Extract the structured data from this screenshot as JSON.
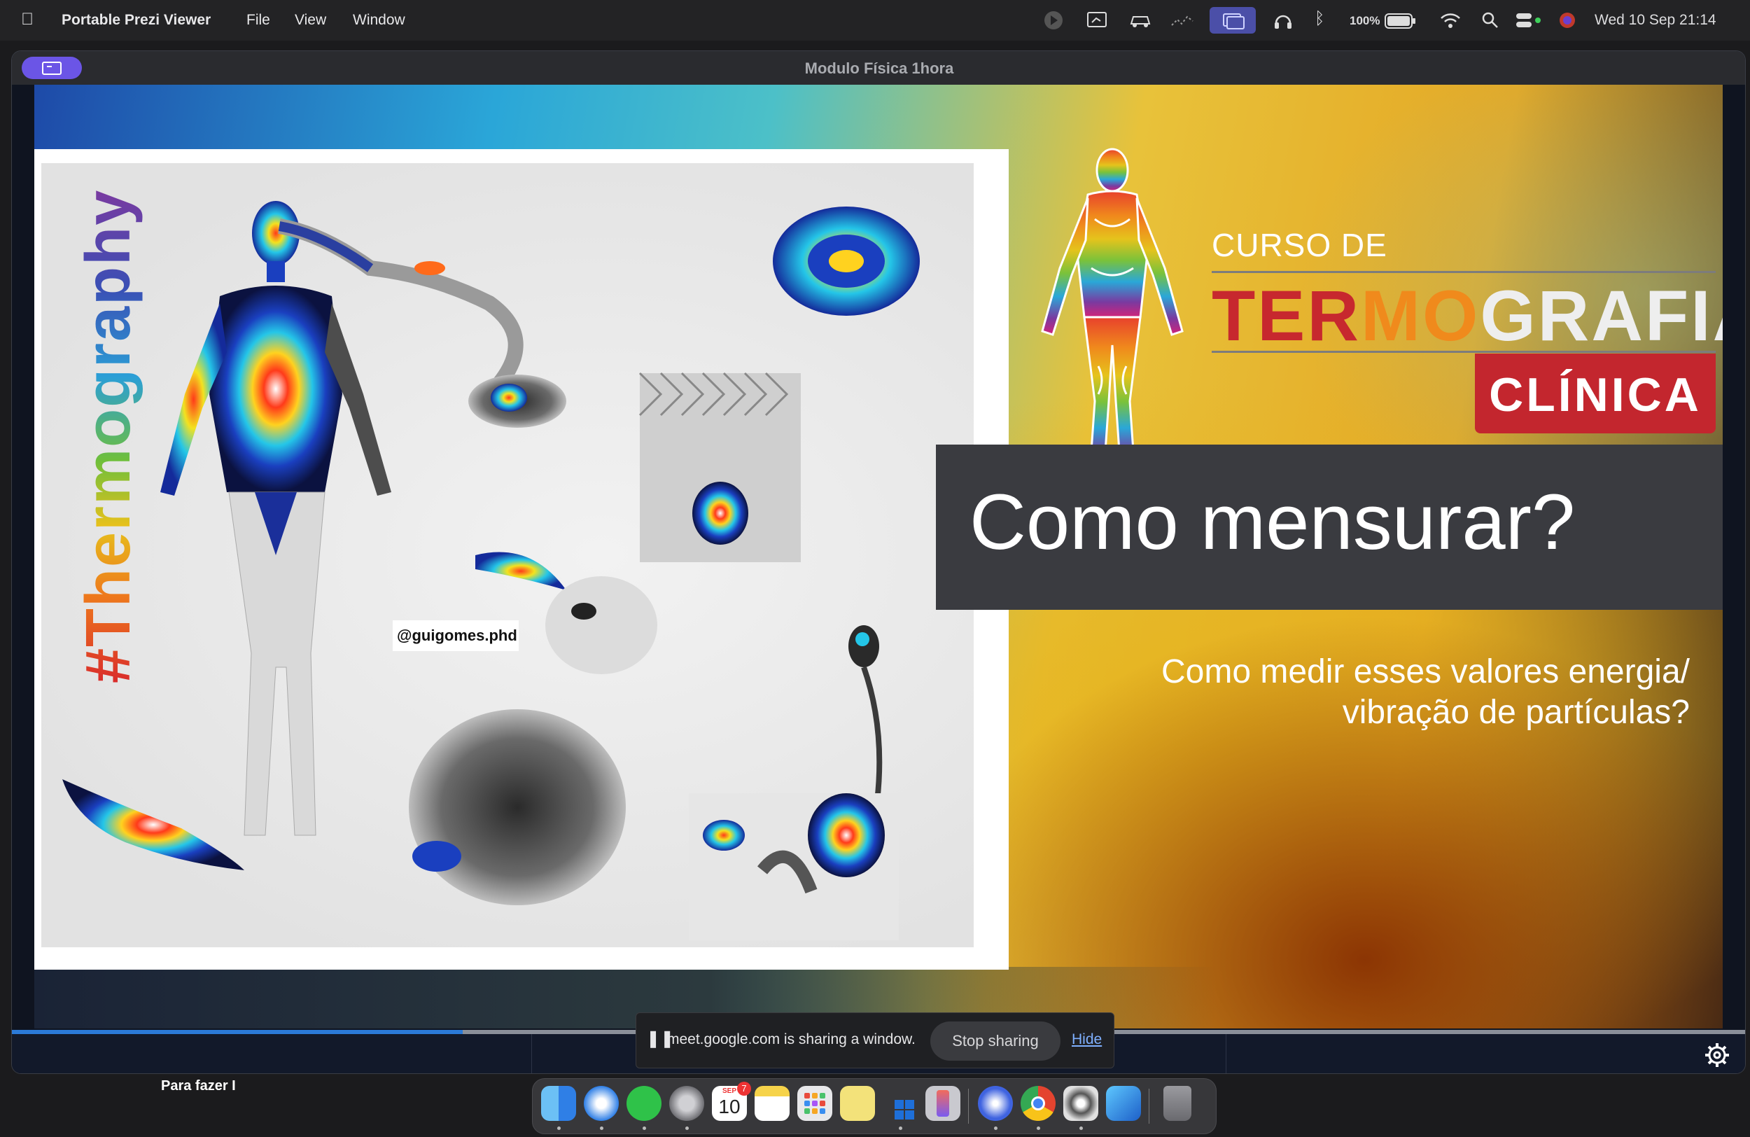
{
  "menubar": {
    "app_name": "Portable Prezi Viewer",
    "menus": [
      "File",
      "View",
      "Window"
    ],
    "battery": "100%",
    "datetime": "Wed 10 Sep  21:14"
  },
  "window": {
    "title": "Modulo Física 1hora"
  },
  "slide": {
    "hashtag": "#Thermography",
    "handle": "@guigomes.phd",
    "curso_de": "CURSO DE",
    "termografia_parts": [
      {
        "text": "TER",
        "color": "#c7282e"
      },
      {
        "text": "MO",
        "color": "#f08a1c"
      },
      {
        "text": "GRAFIA",
        "color": "#eeeeee"
      }
    ],
    "clinica": "CLÍNICA",
    "headline": "Como mensurar?",
    "subtitle_line1": "Como medir esses valores energia/",
    "subtitle_line2": "vibração de partículas?"
  },
  "progress": {
    "value": 0.26
  },
  "share_bar": {
    "message": "meet.google.com is sharing a window.",
    "stop_label": "Stop sharing",
    "hide_label": "Hide"
  },
  "desktop": {
    "widget_label": "Para fazer I"
  },
  "dock": {
    "calendar_month": "SEP",
    "calendar_day": "10",
    "calendar_badge": "7",
    "apps": [
      {
        "name": "finder-icon",
        "color": "#3d8bf0"
      },
      {
        "name": "safari-icon",
        "color": "#2f7fe6"
      },
      {
        "name": "whatsapp-icon",
        "color": "#2fc249"
      },
      {
        "name": "system-settings-icon",
        "color": "#8e8e93"
      },
      {
        "name": "calendar-icon",
        "color": "#ffffff"
      },
      {
        "name": "notes-icon",
        "color": "#f6d34a"
      },
      {
        "name": "launchpad-icon",
        "color": "#e8e8ea"
      },
      {
        "name": "stickies-icon",
        "color": "#f3e27a"
      },
      {
        "name": "windows-app-icon",
        "color": "#1e6fd9"
      },
      {
        "name": "iphone-mirroring-icon",
        "color": "#c9c9cf"
      },
      {
        "name": "prezi-icon",
        "color": "#3f63e0"
      },
      {
        "name": "chrome-icon",
        "color": "#e4442f"
      },
      {
        "name": "screen-recorder-icon",
        "color": "#dcdcdc"
      },
      {
        "name": "affinity-icon",
        "color": "#3ba0f0"
      },
      {
        "name": "trash-icon",
        "color": "#8a8a8f"
      }
    ]
  }
}
